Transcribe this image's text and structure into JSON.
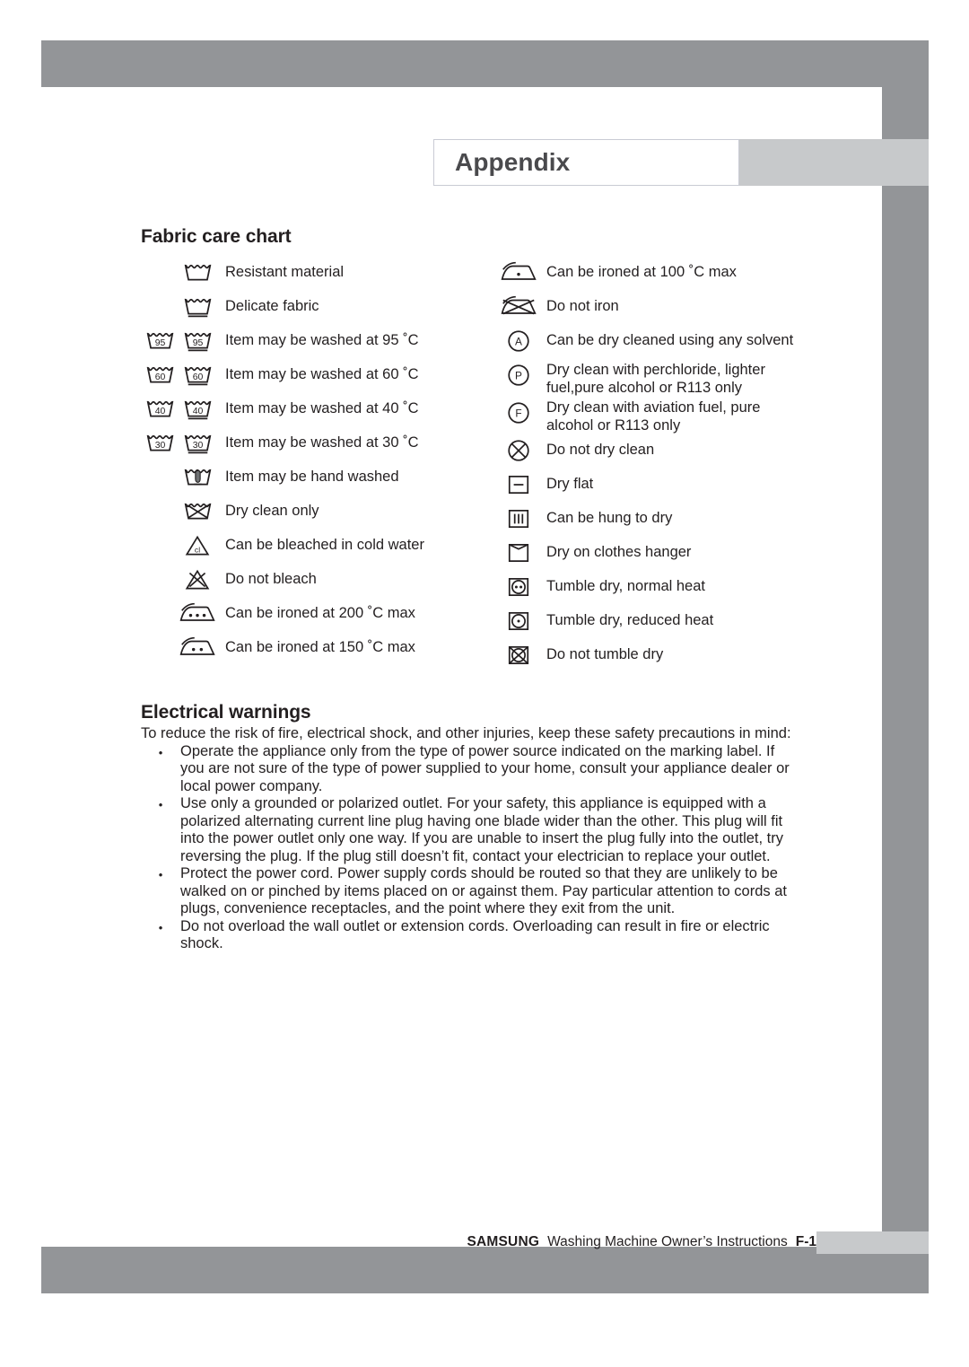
{
  "page": {
    "tab_title": "Appendix",
    "fabric_heading": "Fabric care chart",
    "electrical_heading": "Electrical warnings"
  },
  "care_chart": {
    "left_column": [
      {
        "icons": [
          "",
          "wash-tub"
        ],
        "label": "Resistant material"
      },
      {
        "icons": [
          "",
          "wash-tub-bar1"
        ],
        "label": "Delicate fabric"
      },
      {
        "icons": [
          "wash-tub-95",
          "wash-tub-95-bar1"
        ],
        "label": "Item may be washed at 95 ˚C"
      },
      {
        "icons": [
          "wash-tub-60",
          "wash-tub-60-bar1"
        ],
        "label": "Item may be washed at 60 ˚C"
      },
      {
        "icons": [
          "wash-tub-40",
          "wash-tub-40-bar1"
        ],
        "label": "Item may be washed at 40 ˚C"
      },
      {
        "icons": [
          "wash-tub-30",
          "wash-tub-30-bar1"
        ],
        "label": "Item may be washed at 30 ˚C"
      },
      {
        "icons": [
          "",
          "hand-wash-tub"
        ],
        "label": "Item may be hand washed"
      },
      {
        "icons": [
          "",
          "do-not-wash-tub"
        ],
        "label": "Dry clean only"
      },
      {
        "icons": [
          "",
          "bleach-triangle-cl"
        ],
        "label": "Can be bleached in cold water"
      },
      {
        "icons": [
          "",
          "do-not-bleach-triangle"
        ],
        "label": "Do not bleach"
      },
      {
        "icons": [
          "",
          "iron-three-dots"
        ],
        "label": "Can be ironed at 200 ˚C max"
      },
      {
        "icons": [
          "",
          "iron-two-dots"
        ],
        "label": "Can be ironed at 150 ˚C max"
      }
    ],
    "right_column": [
      {
        "icons": [
          "iron-one-dot"
        ],
        "label": "Can be ironed at 100 ˚C max"
      },
      {
        "icons": [
          "do-not-iron"
        ],
        "label": "Do not iron"
      },
      {
        "icons": [
          "dryclean-circle-a"
        ],
        "label": "Can be dry cleaned using any solvent"
      },
      {
        "icons": [
          "dryclean-circle-p"
        ],
        "label": "Dry clean with perchloride, lighter\nfuel,pure alcohol or R113 only"
      },
      {
        "icons": [
          "dryclean-circle-f"
        ],
        "label": "Dry clean with aviation fuel, pure\nalcohol or R113 only"
      },
      {
        "icons": [
          "do-not-dryclean-circle"
        ],
        "label": "Do not dry clean"
      },
      {
        "icons": [
          "dry-flat-square"
        ],
        "label": "Dry flat"
      },
      {
        "icons": [
          "hung-to-dry-square"
        ],
        "label": "Can be hung to dry"
      },
      {
        "icons": [
          "clothes-hanger-square"
        ],
        "label": "Dry on clothes hanger"
      },
      {
        "icons": [
          "tumble-dry-two-dots"
        ],
        "label": "Tumble dry, normal heat"
      },
      {
        "icons": [
          "tumble-dry-one-dot"
        ],
        "label": "Tumble dry, reduced heat"
      },
      {
        "icons": [
          "do-not-tumble-dry"
        ],
        "label": "Do not tumble dry"
      }
    ]
  },
  "electrical": {
    "intro": "To reduce the risk of fire, electrical shock, and other injuries, keep these safety precautions in mind:",
    "bullet_marker": "•",
    "bullets": [
      "Operate the appliance only from the type of power source indicated on the marking label. If you are not sure of the type of power supplied to your home, consult your appliance dealer or local power company.",
      "Use only a grounded or polarized outlet. For your safety, this appliance is equipped with a polarized alternating current line plug having one blade wider than the other. This plug will fit into the power outlet only one way. If you are unable to insert the plug fully into the outlet, try reversing the plug. If the plug still doesn’t fit, contact your electrician to replace your outlet.",
      "Protect the power cord. Power supply cords should be routed so that they are unlikely to be walked on or pinched by items placed on or against them. Pay particular attention to cords at plugs, convenience receptacles, and the point where they exit from the unit.",
      "Do not overload the wall outlet or extension cords. Overloading can result in fire or electric shock."
    ]
  },
  "footer": {
    "brand": "SAMSUNG",
    "doc_title": "Washing Machine Owner’s Instructions",
    "page_number": "F-1"
  },
  "colors": {
    "frame_gray": "#939598",
    "tab_extension_gray": "#c7c9cb",
    "ink": "#231f20",
    "tab_text": "#4a4a4d"
  }
}
